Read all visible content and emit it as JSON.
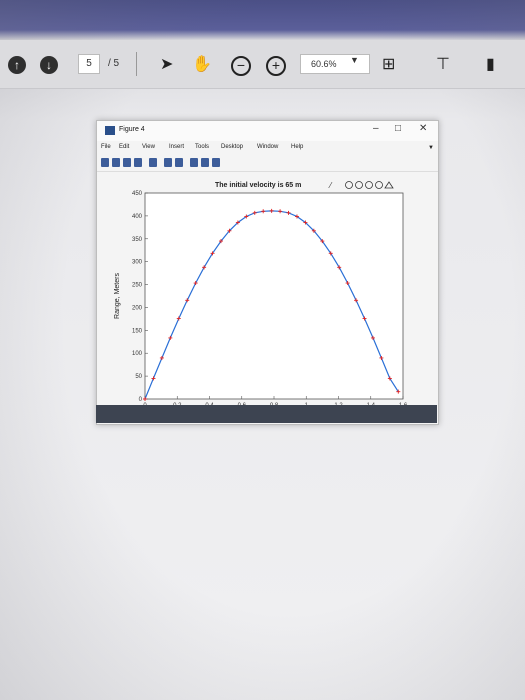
{
  "reader": {
    "page_current": "5",
    "page_total": "/ 5",
    "zoom": "60.6%"
  },
  "figure": {
    "window_title": "Figure 4",
    "menu": [
      "File",
      "Edit",
      "View",
      "Insert",
      "Tools",
      "Desktop",
      "Window",
      "Help"
    ]
  },
  "chart_data": {
    "type": "line",
    "title": "The initial velocity is 65 m",
    "xlabel": "",
    "ylabel": "Range, Meters",
    "xlim": [
      0,
      1.6
    ],
    "ylim": [
      0,
      450
    ],
    "xticks": [
      0,
      0.2,
      0.4,
      0.6,
      0.8,
      1,
      1.2,
      1.4,
      1.6
    ],
    "xtick_labels": [
      "0",
      "0.2",
      "0.4",
      "0.6",
      "0.8",
      "1",
      "1.2",
      "1.4",
      "1.6"
    ],
    "yticks": [
      0,
      50,
      100,
      150,
      200,
      250,
      300,
      350,
      400,
      450
    ],
    "ytick_labels": [
      "0",
      "50",
      "100",
      "150",
      "200",
      "250",
      "300",
      "350",
      "400",
      "450"
    ],
    "series": [
      {
        "line_color": "#2a6fd6",
        "marker_color": "#e02020",
        "x": [
          0.0,
          0.0524,
          0.1047,
          0.1571,
          0.2094,
          0.2618,
          0.3142,
          0.3665,
          0.4189,
          0.4712,
          0.5236,
          0.576,
          0.6283,
          0.6807,
          0.733,
          0.7854,
          0.8378,
          0.8901,
          0.9425,
          0.9948,
          1.0472,
          1.0996,
          1.1519,
          1.2043,
          1.2566,
          1.309,
          1.3614,
          1.4137,
          1.4661,
          1.5184,
          1.5708
        ],
        "y": [
          0.0,
          45.0,
          89.6,
          133.4,
          175.9,
          215.6,
          253.3,
          287.6,
          318.2,
          345.0,
          367.4,
          385.5,
          398.6,
          406.7,
          410.0,
          411.0,
          410.0,
          406.7,
          398.6,
          385.5,
          367.4,
          345.0,
          318.2,
          287.6,
          253.3,
          215.6,
          175.9,
          133.4,
          89.6,
          45.0,
          16.0
        ]
      }
    ]
  }
}
